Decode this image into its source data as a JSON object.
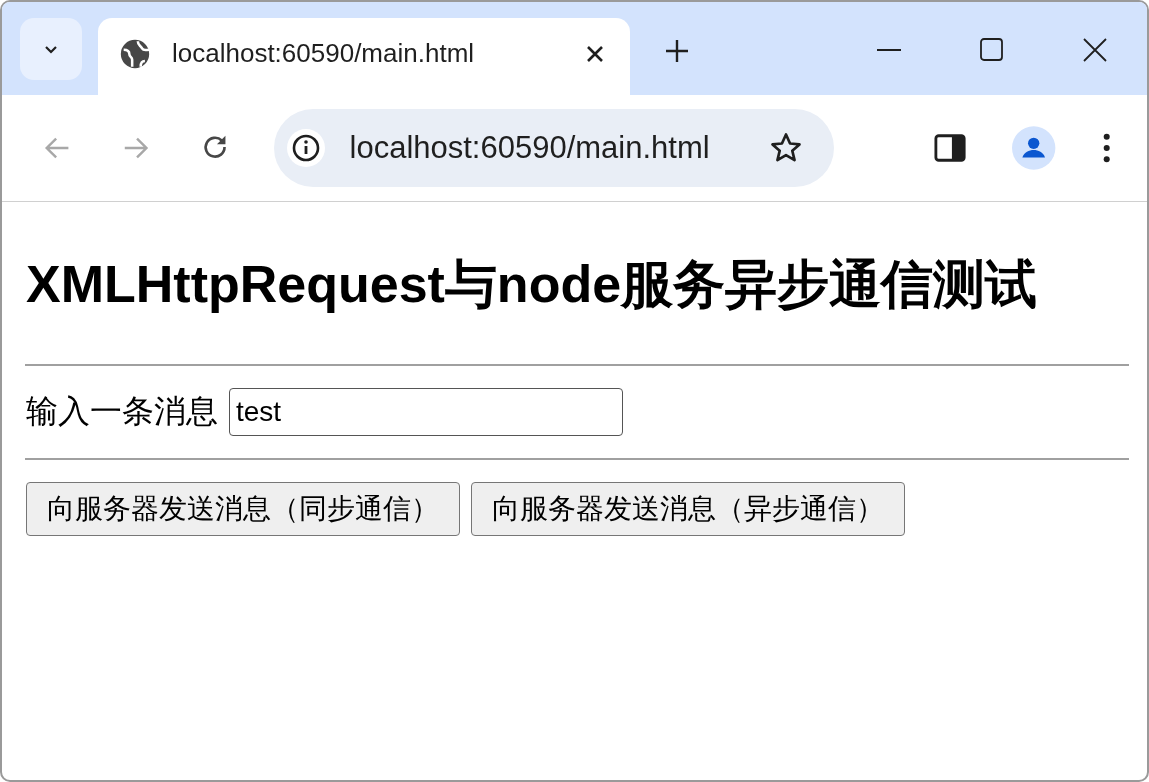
{
  "browser": {
    "tab": {
      "title": "localhost:60590/main.html",
      "selected": true
    },
    "address": "localhost:60590/main.html",
    "nav": {
      "back_disabled": true,
      "forward_disabled": true
    }
  },
  "page": {
    "heading": "XMLHttpRequest与node服务异步通信测试",
    "field_label": "输入一条消息",
    "message": "test",
    "buttons": [
      "向服务器发送消息（同步通信）",
      "向服务器发送消息（异步通信）"
    ]
  }
}
